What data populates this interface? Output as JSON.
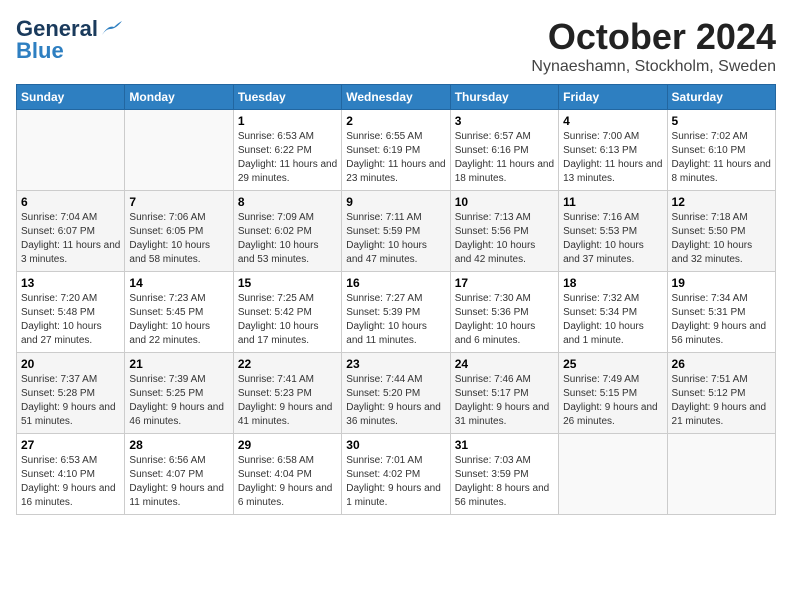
{
  "header": {
    "logo_general": "General",
    "logo_blue": "Blue",
    "title": "October 2024",
    "location": "Nynaeshamn, Stockholm, Sweden"
  },
  "days_of_week": [
    "Sunday",
    "Monday",
    "Tuesday",
    "Wednesday",
    "Thursday",
    "Friday",
    "Saturday"
  ],
  "weeks": [
    [
      {
        "day": "",
        "info": ""
      },
      {
        "day": "",
        "info": ""
      },
      {
        "day": "1",
        "info": "Sunrise: 6:53 AM\nSunset: 6:22 PM\nDaylight: 11 hours and 29 minutes."
      },
      {
        "day": "2",
        "info": "Sunrise: 6:55 AM\nSunset: 6:19 PM\nDaylight: 11 hours and 23 minutes."
      },
      {
        "day": "3",
        "info": "Sunrise: 6:57 AM\nSunset: 6:16 PM\nDaylight: 11 hours and 18 minutes."
      },
      {
        "day": "4",
        "info": "Sunrise: 7:00 AM\nSunset: 6:13 PM\nDaylight: 11 hours and 13 minutes."
      },
      {
        "day": "5",
        "info": "Sunrise: 7:02 AM\nSunset: 6:10 PM\nDaylight: 11 hours and 8 minutes."
      }
    ],
    [
      {
        "day": "6",
        "info": "Sunrise: 7:04 AM\nSunset: 6:07 PM\nDaylight: 11 hours and 3 minutes."
      },
      {
        "day": "7",
        "info": "Sunrise: 7:06 AM\nSunset: 6:05 PM\nDaylight: 10 hours and 58 minutes."
      },
      {
        "day": "8",
        "info": "Sunrise: 7:09 AM\nSunset: 6:02 PM\nDaylight: 10 hours and 53 minutes."
      },
      {
        "day": "9",
        "info": "Sunrise: 7:11 AM\nSunset: 5:59 PM\nDaylight: 10 hours and 47 minutes."
      },
      {
        "day": "10",
        "info": "Sunrise: 7:13 AM\nSunset: 5:56 PM\nDaylight: 10 hours and 42 minutes."
      },
      {
        "day": "11",
        "info": "Sunrise: 7:16 AM\nSunset: 5:53 PM\nDaylight: 10 hours and 37 minutes."
      },
      {
        "day": "12",
        "info": "Sunrise: 7:18 AM\nSunset: 5:50 PM\nDaylight: 10 hours and 32 minutes."
      }
    ],
    [
      {
        "day": "13",
        "info": "Sunrise: 7:20 AM\nSunset: 5:48 PM\nDaylight: 10 hours and 27 minutes."
      },
      {
        "day": "14",
        "info": "Sunrise: 7:23 AM\nSunset: 5:45 PM\nDaylight: 10 hours and 22 minutes."
      },
      {
        "day": "15",
        "info": "Sunrise: 7:25 AM\nSunset: 5:42 PM\nDaylight: 10 hours and 17 minutes."
      },
      {
        "day": "16",
        "info": "Sunrise: 7:27 AM\nSunset: 5:39 PM\nDaylight: 10 hours and 11 minutes."
      },
      {
        "day": "17",
        "info": "Sunrise: 7:30 AM\nSunset: 5:36 PM\nDaylight: 10 hours and 6 minutes."
      },
      {
        "day": "18",
        "info": "Sunrise: 7:32 AM\nSunset: 5:34 PM\nDaylight: 10 hours and 1 minute."
      },
      {
        "day": "19",
        "info": "Sunrise: 7:34 AM\nSunset: 5:31 PM\nDaylight: 9 hours and 56 minutes."
      }
    ],
    [
      {
        "day": "20",
        "info": "Sunrise: 7:37 AM\nSunset: 5:28 PM\nDaylight: 9 hours and 51 minutes."
      },
      {
        "day": "21",
        "info": "Sunrise: 7:39 AM\nSunset: 5:25 PM\nDaylight: 9 hours and 46 minutes."
      },
      {
        "day": "22",
        "info": "Sunrise: 7:41 AM\nSunset: 5:23 PM\nDaylight: 9 hours and 41 minutes."
      },
      {
        "day": "23",
        "info": "Sunrise: 7:44 AM\nSunset: 5:20 PM\nDaylight: 9 hours and 36 minutes."
      },
      {
        "day": "24",
        "info": "Sunrise: 7:46 AM\nSunset: 5:17 PM\nDaylight: 9 hours and 31 minutes."
      },
      {
        "day": "25",
        "info": "Sunrise: 7:49 AM\nSunset: 5:15 PM\nDaylight: 9 hours and 26 minutes."
      },
      {
        "day": "26",
        "info": "Sunrise: 7:51 AM\nSunset: 5:12 PM\nDaylight: 9 hours and 21 minutes."
      }
    ],
    [
      {
        "day": "27",
        "info": "Sunrise: 6:53 AM\nSunset: 4:10 PM\nDaylight: 9 hours and 16 minutes."
      },
      {
        "day": "28",
        "info": "Sunrise: 6:56 AM\nSunset: 4:07 PM\nDaylight: 9 hours and 11 minutes."
      },
      {
        "day": "29",
        "info": "Sunrise: 6:58 AM\nSunset: 4:04 PM\nDaylight: 9 hours and 6 minutes."
      },
      {
        "day": "30",
        "info": "Sunrise: 7:01 AM\nSunset: 4:02 PM\nDaylight: 9 hours and 1 minute."
      },
      {
        "day": "31",
        "info": "Sunrise: 7:03 AM\nSunset: 3:59 PM\nDaylight: 8 hours and 56 minutes."
      },
      {
        "day": "",
        "info": ""
      },
      {
        "day": "",
        "info": ""
      }
    ]
  ]
}
